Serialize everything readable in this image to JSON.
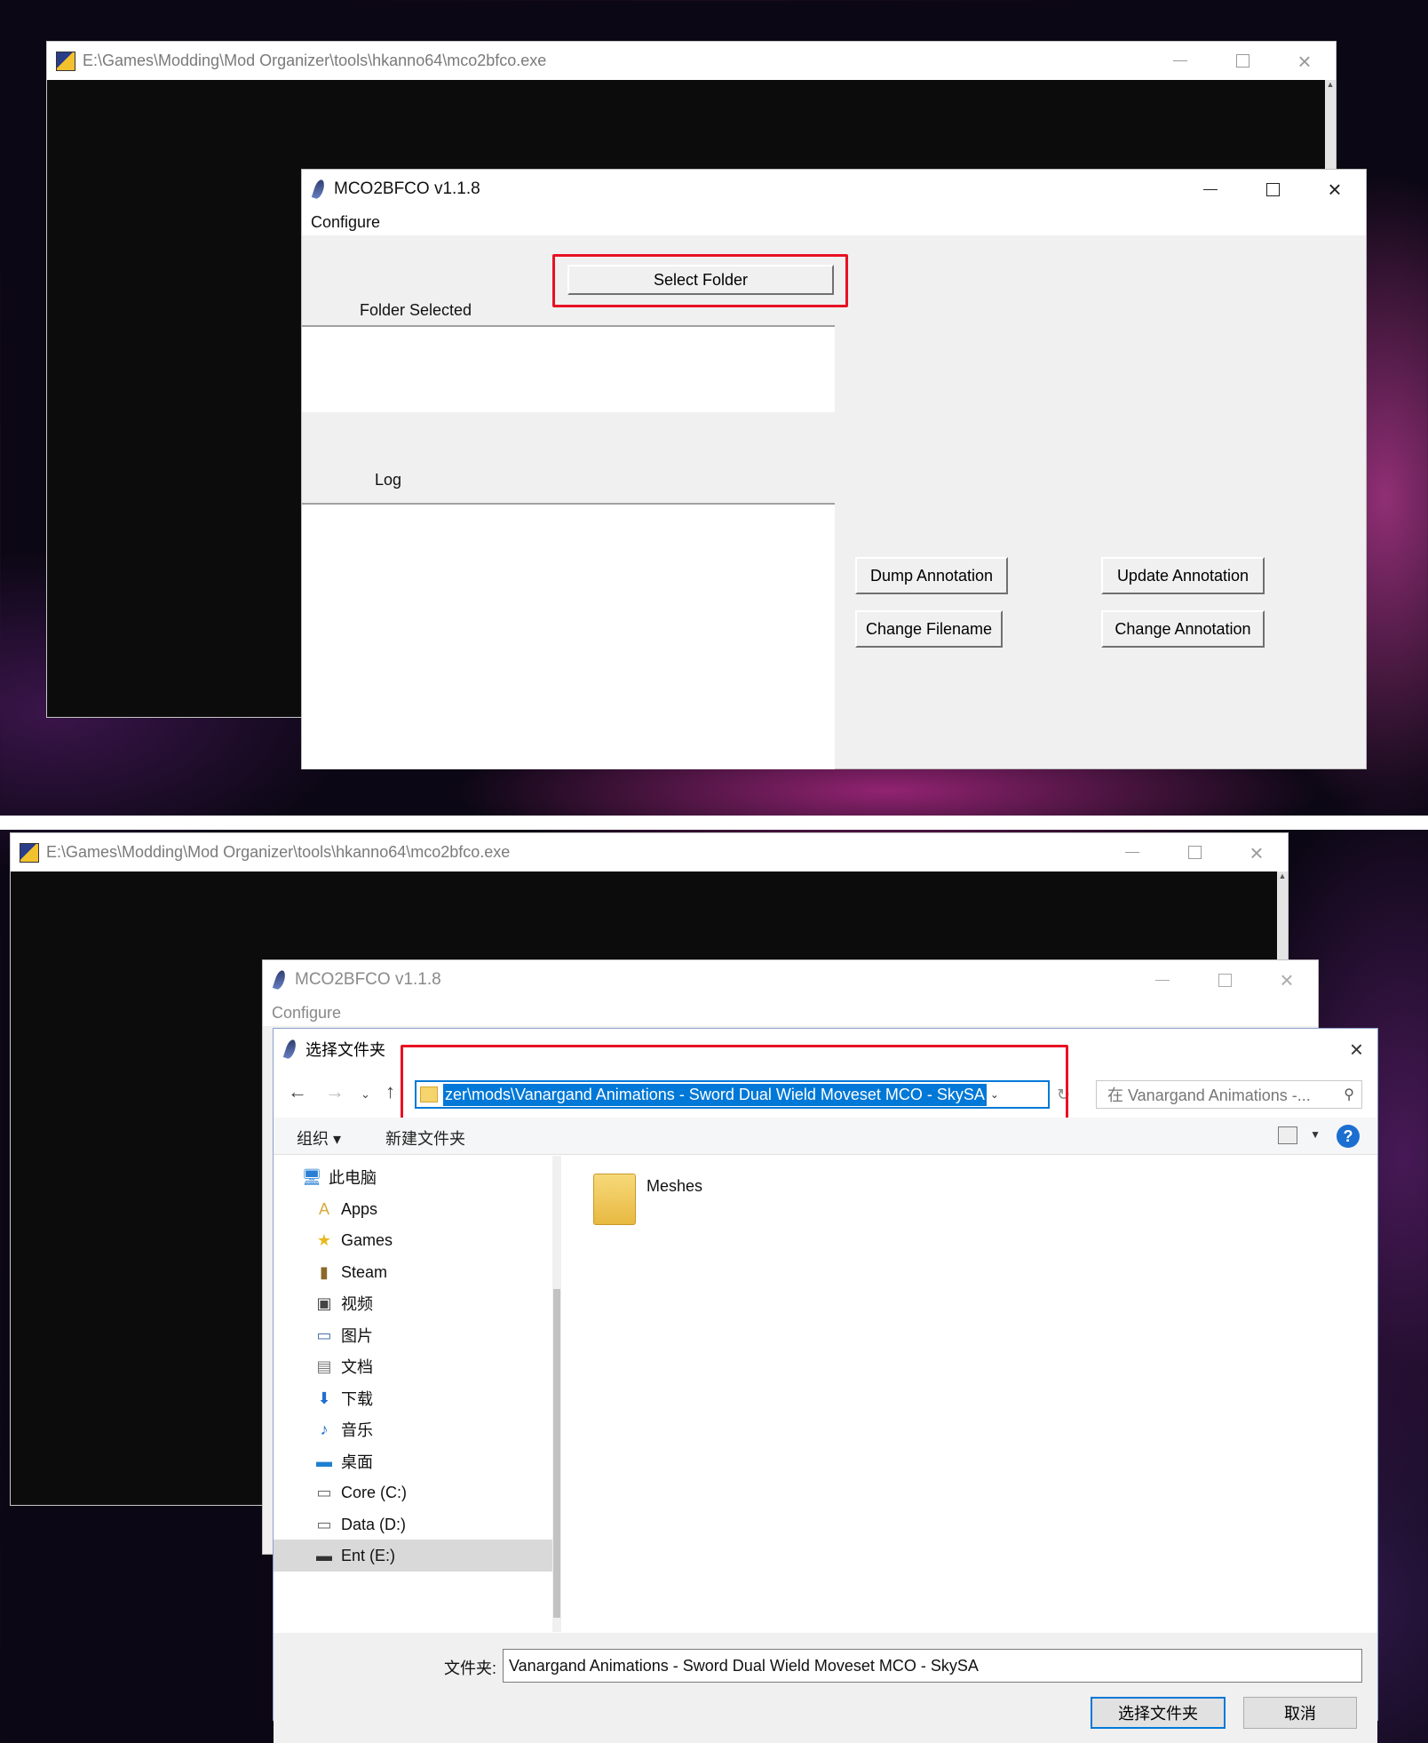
{
  "top": {
    "console_title": "E:\\Games\\Modding\\Mod Organizer\\tools\\hkanno64\\mco2bfco.exe",
    "app_title": "MCO2BFCO v1.1.8",
    "menu_configure": "Configure",
    "select_folder": "Select Folder",
    "folder_selected_label": "Folder Selected",
    "log_label": "Log",
    "dump_annotation": "Dump Annotation",
    "update_annotation": "Update Annotation",
    "change_filename": "Change Filename",
    "change_annotation": "Change Annotation"
  },
  "bottom": {
    "console_title": "E:\\Games\\Modding\\Mod Organizer\\tools\\hkanno64\\mco2bfco.exe",
    "app_title": "MCO2BFCO v1.1.8",
    "menu_configure": "Configure",
    "dialog": {
      "title": "选择文件夹",
      "address": "zer\\mods\\Vanargand Animations - Sword Dual Wield Moveset MCO - SkySA",
      "search_placeholder": "在 Vanargand Animations -...",
      "organize": "组织 ▾",
      "new_folder": "新建文件夹",
      "help": "?",
      "tree": [
        {
          "label": "此电脑",
          "icon": "computer-icon",
          "glyph": "🖥"
        },
        {
          "label": "Apps",
          "icon": "apps-folder-icon",
          "glyph": "A"
        },
        {
          "label": "Games",
          "icon": "star-icon",
          "glyph": "★"
        },
        {
          "label": "Steam",
          "icon": "steam-folder-icon",
          "glyph": "▮"
        },
        {
          "label": "视频",
          "icon": "video-icon",
          "glyph": "▣"
        },
        {
          "label": "图片",
          "icon": "picture-icon",
          "glyph": "▭"
        },
        {
          "label": "文档",
          "icon": "document-icon",
          "glyph": "▤"
        },
        {
          "label": "下载",
          "icon": "download-icon",
          "glyph": "⬇"
        },
        {
          "label": "音乐",
          "icon": "music-icon",
          "glyph": "♪"
        },
        {
          "label": "桌面",
          "icon": "desktop-icon",
          "glyph": "▬"
        },
        {
          "label": "Core (C:)",
          "icon": "drive-c-icon",
          "glyph": "▭"
        },
        {
          "label": "Data (D:)",
          "icon": "drive-d-icon",
          "glyph": "▭"
        },
        {
          "label": "Ent (E:)",
          "icon": "drive-e-icon",
          "glyph": "▬"
        }
      ],
      "selected_tree_item": "Ent (E:)",
      "content_items": [
        {
          "label": "Meshes",
          "icon": "folder-icon"
        }
      ],
      "folder_label": "文件夹:",
      "folder_value": "Vanargand Animations - Sword Dual Wield Moveset MCO - SkySA",
      "ok": "选择文件夹",
      "cancel": "取消"
    }
  },
  "colors": {
    "highlight_red": "#e81123",
    "selection_blue": "#0078d7"
  }
}
